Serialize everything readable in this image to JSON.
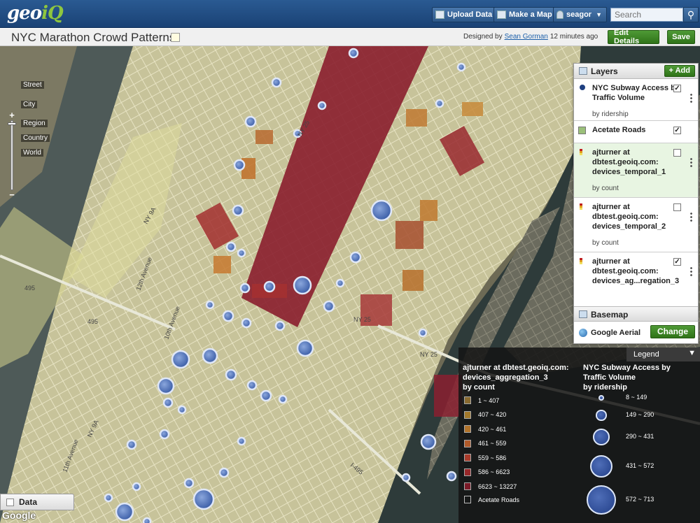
{
  "app": {
    "logo_main": "geo",
    "logo_accent": "iQ"
  },
  "topbar": {
    "upload_label": "Upload Data",
    "make_map_label": "Make a Map",
    "user_label": "seagor",
    "search_placeholder": "Search"
  },
  "titlebar": {
    "map_title": "NYC Marathon Crowd Patterns",
    "designed_by_prefix": "Designed by",
    "designer": "Sean Gorman",
    "updated": "12 minutes ago",
    "edit_details_label": "Edit Details",
    "save_label": "Save"
  },
  "zoom": {
    "plus": "+",
    "minus": "−",
    "levels": [
      "Street",
      "City",
      "Region",
      "Country",
      "World"
    ]
  },
  "layers": {
    "title": "Layers",
    "add_label": "+ Add",
    "items": [
      {
        "name": "NYC Subway Access by Traffic Volume",
        "sub": "by ridership",
        "checked": "✓",
        "icon": "subway-dot-icon"
      },
      {
        "name": "Acetate Roads",
        "sub": "",
        "checked": "✓",
        "icon": "roads-icon"
      },
      {
        "name": "ajturner at dbtest.geoiq.com: devices_temporal_1",
        "sub": "by count",
        "checked": "",
        "icon": "choropleth-icon"
      },
      {
        "name": "ajturner at dbtest.geoiq.com: devices_temporal_2",
        "sub": "by count",
        "checked": "",
        "icon": "choropleth-icon"
      },
      {
        "name": "ajturner at dbtest.geoiq.com: devices_ag...regation_3",
        "sub": "by count",
        "checked": "✓",
        "icon": "choropleth-icon"
      }
    ]
  },
  "basemap": {
    "title": "Basemap",
    "name": "Google Aerial",
    "change_label": "Change"
  },
  "legend": {
    "header": "Legend",
    "col1_title": "ajturner at dbtest.geoiq.com: devices_aggregation_3",
    "col1_sub": "by count",
    "col1_ranges": [
      {
        "label": "1 ~ 407",
        "color": "#8a6a30"
      },
      {
        "label": "407 ~ 420",
        "color": "#a2772a"
      },
      {
        "label": "420 ~ 461",
        "color": "#b0722a"
      },
      {
        "label": "461 ~ 559",
        "color": "#b05a2a"
      },
      {
        "label": "559 ~ 586",
        "color": "#a83a2a"
      },
      {
        "label": "586 ~ 6623",
        "color": "#98282a"
      },
      {
        "label": "6623 ~ 13227",
        "color": "#7a1a28"
      }
    ],
    "roads_label": "Acetate Roads",
    "col2_title": "NYC Subway Access by Traffic Volume",
    "col2_sub": "by ridership",
    "col2_ranges": [
      "8 ~ 149",
      "149 ~ 290",
      "290 ~ 431",
      "431 ~ 572",
      "572 ~ 713"
    ]
  },
  "map_labels": {
    "highways": [
      "495",
      "495",
      "NY 25",
      "NY 25",
      "I-495",
      "NY 9A",
      "NY 9A",
      "NY 25"
    ],
    "avenues": [
      "12th Avenue",
      "11th Avenue",
      "10th Avenue"
    ]
  },
  "data_tab": {
    "label": "Data"
  },
  "attribution": {
    "google": "Google"
  }
}
